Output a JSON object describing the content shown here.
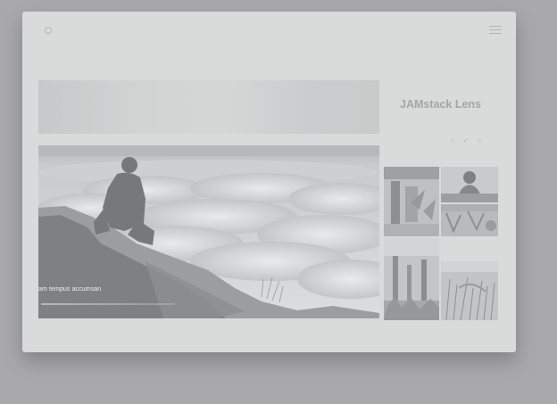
{
  "site": {
    "title": "JAMstack Lens",
    "logo_icon": "logo-dot-icon",
    "menu_icon": "hamburger-menu-icon"
  },
  "social": [
    "twitter-icon",
    "github-icon",
    "instagram-icon"
  ],
  "hero": {
    "caption": "am tempus accumsan"
  },
  "gallery": {
    "thumbnails": [
      "thumbnail-plants-window",
      "thumbnail-person-portrait",
      "thumbnail-hanging-plants",
      "thumbnail-cactus-garden",
      "thumbnail-grass-field"
    ]
  },
  "colors": {
    "page_background": "#a9a9ad",
    "window_background": "#d9dada",
    "title_text": "#a4a5a6"
  }
}
